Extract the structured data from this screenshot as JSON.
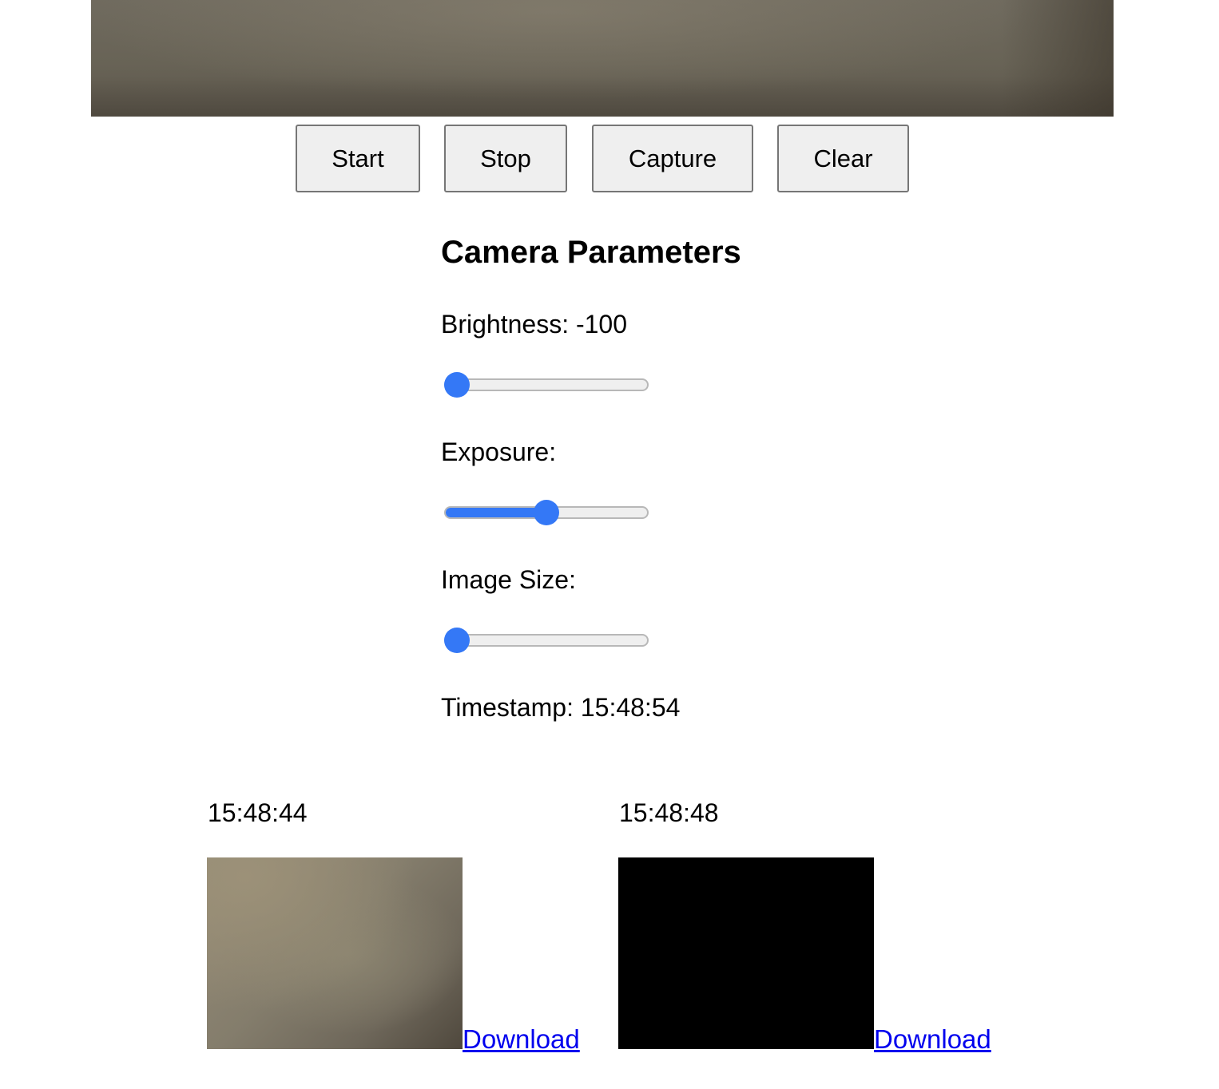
{
  "toolbar": {
    "start_label": "Start",
    "stop_label": "Stop",
    "capture_label": "Capture",
    "clear_label": "Clear"
  },
  "params": {
    "title": "Camera Parameters",
    "brightness_label": "Brightness: -100",
    "brightness_level": 0.0,
    "exposure_label": "Exposure:",
    "exposure_level": 0.5,
    "image_size_label": "Image Size:",
    "image_size_level": 0.0,
    "timestamp_label": "Timestamp: 15:48:54"
  },
  "captures": [
    {
      "time": "15:48:44",
      "download_label": "Download"
    },
    {
      "time": "15:48:48",
      "download_label": "Download"
    }
  ],
  "colors": {
    "slider_accent": "#3478f6",
    "link": "#0000ee"
  }
}
